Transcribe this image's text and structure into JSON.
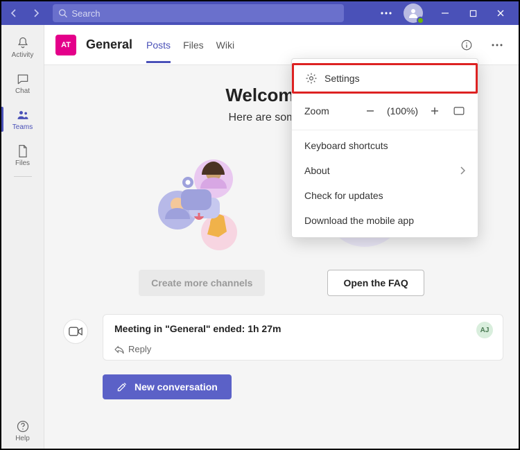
{
  "titlebar": {
    "searchPlaceholder": "Search"
  },
  "rail": {
    "items": [
      {
        "label": "Activity"
      },
      {
        "label": "Chat"
      },
      {
        "label": "Teams"
      },
      {
        "label": "Files"
      }
    ],
    "help": "Help"
  },
  "channel": {
    "teamInitials": "AT",
    "name": "General",
    "tabs": [
      "Posts",
      "Files",
      "Wiki"
    ]
  },
  "welcome": {
    "title": "Welcome to t",
    "subtitle": "Here are some things"
  },
  "buttons": {
    "createChannels": "Create more channels",
    "openFaq": "Open the FAQ",
    "newConversation": "New conversation"
  },
  "meeting": {
    "text": "Meeting in \"General\" ended: 1h 27m",
    "reply": "Reply",
    "participant": "AJ"
  },
  "menu": {
    "settings": "Settings",
    "zoomLabel": "Zoom",
    "zoomValue": "(100%)",
    "keyboard": "Keyboard shortcuts",
    "about": "About",
    "check": "Check for updates",
    "download": "Download the mobile app"
  }
}
